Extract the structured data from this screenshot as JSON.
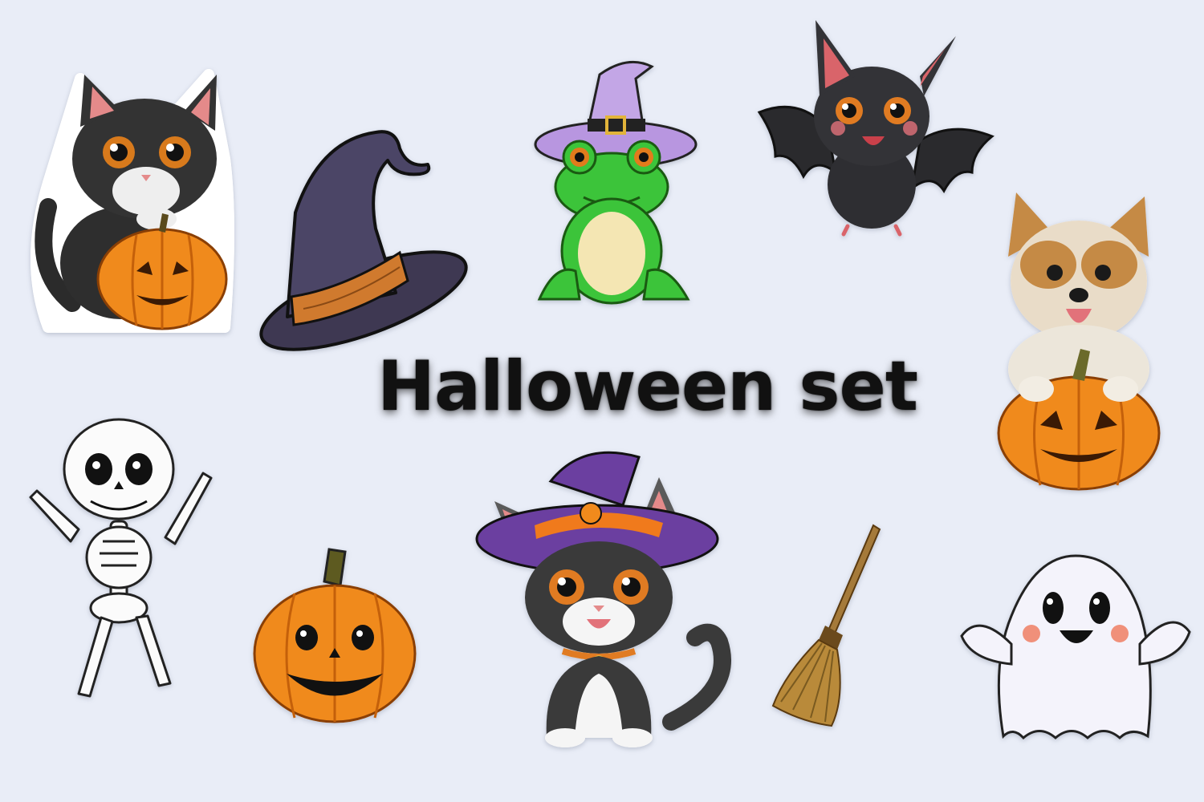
{
  "title": "Halloween set",
  "background_color": "#e9edf7",
  "stickers": [
    {
      "icon": "kitten-with-pumpkin-icon"
    },
    {
      "icon": "witch-hat-icon"
    },
    {
      "icon": "frog-in-witch-hat-icon"
    },
    {
      "icon": "bat-icon"
    },
    {
      "icon": "terrier-with-pumpkin-icon"
    },
    {
      "icon": "skeleton-icon"
    },
    {
      "icon": "jack-o-lantern-icon"
    },
    {
      "icon": "cat-in-witch-hat-icon"
    },
    {
      "icon": "broom-icon"
    },
    {
      "icon": "ghost-icon"
    }
  ],
  "colors": {
    "pumpkin": "#f08a1c",
    "witch_purple": "#6b3fa0",
    "frog_green": "#3cc43a",
    "ghost_white": "#f4f3fb",
    "outline": "#1a1a1a"
  }
}
